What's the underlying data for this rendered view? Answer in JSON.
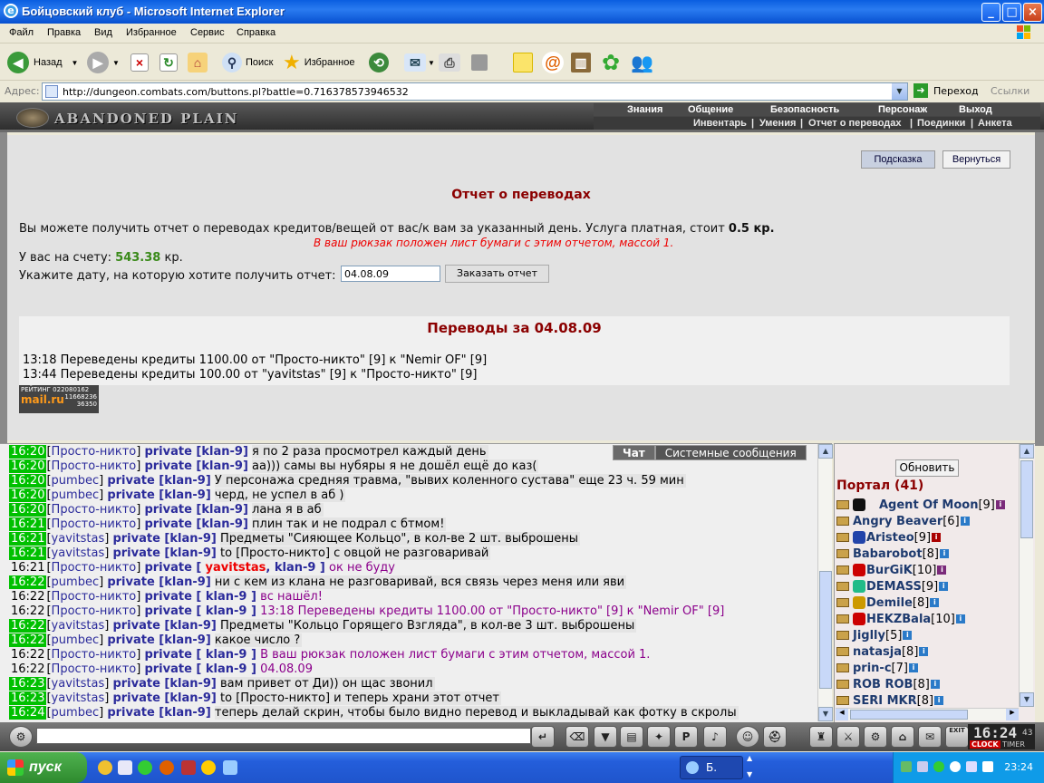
{
  "window": {
    "title": "Бойцовский клуб - Microsoft Internet Explorer",
    "min": "_",
    "max": "□",
    "close": "×"
  },
  "menu": [
    "Файл",
    "Правка",
    "Вид",
    "Избранное",
    "Сервис",
    "Справка"
  ],
  "toolbar": {
    "back": "Назад",
    "search": "Поиск",
    "favorites": "Избранное"
  },
  "address": {
    "label": "Адрес:",
    "url": "http://dungeon.combats.com/buttons.pl?battle=0.716378573946532",
    "go": "Переход",
    "links": "Ссылки"
  },
  "game": {
    "title": "ABANDONED PLAIN",
    "nav_top": [
      "Знания",
      "Общение",
      "Безопасность",
      "Персонаж",
      "Выход"
    ],
    "nav_bottom": [
      "Инвентарь",
      "|",
      "Умения",
      "|",
      "Отчет о переводах",
      "|",
      "Поединки",
      "|",
      "Анкета"
    ]
  },
  "page": {
    "hint_button": "Подсказка",
    "back_button": "Вернуться",
    "title": "Отчет о переводах",
    "description": "Вы можете получить отчет о переводах кредитов/вещей от вас/к вам за указанный день. Услуга платная, стоит ",
    "price": "0.5 кр.",
    "notice": "В ваш рюкзак положен лист бумаги с этим отчетом, массой 1.",
    "balance_label": "У вас на счету: ",
    "balance": "543.38",
    "balance_unit": " кр.",
    "date_label": "Укажите дату, на которую хотите получить отчет:",
    "date_value": "04.08.09",
    "order_button": "Заказать отчет",
    "transfers_title": "Переводы за 04.08.09",
    "transfers": [
      "13:18 Переведены кредиты 1100.00 от \"Просто-никто\" [9] к \"Nemir OF\" [9]",
      "13:44 Переведены кредиты 100.00 от \"yavitstas\" [9] к \"Просто-никто\" [9]"
    ],
    "counter": {
      "label": "РЕЙТИНГ",
      "brand": "mail.ru",
      "n1": "022080162",
      "n2": "11668236",
      "n3": "36350"
    }
  },
  "chat": {
    "tabs": [
      "Чат",
      "Системные сообщения"
    ],
    "lines": [
      {
        "time": "16:20",
        "green": true,
        "sender": "Просто-никто",
        "priv": "private [klan-9]",
        "msg": "я по 2 раза просмотрел каждый день",
        "hl": true
      },
      {
        "time": "16:20",
        "green": true,
        "sender": "Просто-никто",
        "priv": "private [klan-9]",
        "msg": "аа))) самы вы нубяры я не дошёл ещё до каз(",
        "hl": true
      },
      {
        "time": "16:20",
        "green": true,
        "sender": "pumbec",
        "priv": "private [klan-9]",
        "msg": "У персонажа средняя травма, \"вывих коленного сустава\" еще 23 ч. 59 мин",
        "hl": true
      },
      {
        "time": "16:20",
        "green": true,
        "sender": "pumbec",
        "priv": "private [klan-9]",
        "msg": "черд, не успел в аб )",
        "hl": true
      },
      {
        "time": "16:20",
        "green": true,
        "sender": "Просто-никто",
        "priv": "private [klan-9]",
        "msg": "лана я в аб",
        "hl": true
      },
      {
        "time": "16:21",
        "green": true,
        "sender": "Просто-никто",
        "priv": "private [klan-9]",
        "msg": "плин так и не подрал с бтмом!",
        "hl": true
      },
      {
        "time": "16:21",
        "green": true,
        "sender": "yavitstas",
        "priv": "private [klan-9]",
        "msg": "Предметы \"Сияющее Кольцо\", в кол-ве 2 шт. выброшены",
        "hl": true
      },
      {
        "time": "16:21",
        "green": true,
        "sender": "yavitstas",
        "priv": "private [klan-9]",
        "msg": "to [Просто-никто] с овцой не разговаривай",
        "hl": true
      },
      {
        "time": "16:21",
        "green": false,
        "sender": "Просто-никто",
        "priv": "private [",
        "red": "yavitstas",
        "priv2": ", klan-9 ]",
        "msg": "ок не буду",
        "purple": true
      },
      {
        "time": "16:22",
        "green": true,
        "sender": "pumbec",
        "priv": "private [klan-9]",
        "msg": "ни с кем из клана не разговаривай, вся связь через меня или яви",
        "hl": true
      },
      {
        "time": "16:22",
        "green": false,
        "sender": "Просто-никто",
        "priv": "private [ klan-9 ]",
        "msg": "вс нашёл!",
        "purple": true
      },
      {
        "time": "16:22",
        "green": false,
        "sender": "Просто-никто",
        "priv": "private [ klan-9 ]",
        "msg": "13:18 Переведены кредиты 1100.00 от \"Просто-никто\" [9] к \"Nemir OF\" [9]",
        "purple": true
      },
      {
        "time": "16:22",
        "green": true,
        "sender": "yavitstas",
        "priv": "private [klan-9]",
        "msg": "Предметы \"Кольцо Горящего Взгляда\", в кол-ве 3 шт. выброшены",
        "hl": true
      },
      {
        "time": "16:22",
        "green": true,
        "sender": "pumbec",
        "priv": "private [klan-9]",
        "msg": "какое число ?",
        "hl": true
      },
      {
        "time": "16:22",
        "green": false,
        "sender": "Просто-никто",
        "priv": "private [ klan-9 ]",
        "msg": "В ваш рюкзак положен лист бумаги с этим отчетом, массой 1.",
        "purple": true
      },
      {
        "time": "16:22",
        "green": false,
        "sender": "Просто-никто",
        "priv": "private [ klan-9 ]",
        "msg": "04.08.09",
        "purple": true
      },
      {
        "time": "16:23",
        "green": true,
        "sender": "yavitstas",
        "priv": "private [klan-9]",
        "msg": "вам привет от Ди)) он щас звонил",
        "hl": true
      },
      {
        "time": "16:23",
        "green": true,
        "sender": "yavitstas",
        "priv": "private [klan-9]",
        "msg": "to [Просто-никто] и теперь храни этот отчет",
        "hl": true
      },
      {
        "time": "16:24",
        "green": true,
        "sender": "pumbec",
        "priv": "private [klan-9]",
        "msg": "теперь делай скрин, чтобы было видно перевод и выкладывай как фотку в скролы",
        "hl": true
      }
    ]
  },
  "online": {
    "refresh": "Обновить",
    "title": "Портал (41)",
    "players": [
      {
        "nick": "Agent Of Moon",
        "lvl": "[9]"
      },
      {
        "nick": "Angry Beaver",
        "lvl": "[6]"
      },
      {
        "nick": "Aristeo",
        "lvl": "[9]"
      },
      {
        "nick": "Babarobot",
        "lvl": "[8]"
      },
      {
        "nick": "BurGiK",
        "lvl": "[10]"
      },
      {
        "nick": "DEMASS",
        "lvl": "[9]"
      },
      {
        "nick": "Demile",
        "lvl": "[8]"
      },
      {
        "nick": "HEKZBala",
        "lvl": "[10]"
      },
      {
        "nick": "Jiglly",
        "lvl": "[5]"
      },
      {
        "nick": "natasja",
        "lvl": "[8]"
      },
      {
        "nick": "prin-c",
        "lvl": "[7]"
      },
      {
        "nick": "ROB ROB",
        "lvl": "[8]"
      },
      {
        "nick": "SERI MKR",
        "lvl": "[8]"
      }
    ]
  },
  "bottom": {
    "clock": "16:24",
    "clock_sec": "43",
    "clock_label": "CLOCK",
    "timer_label": "TIMER",
    "exit": "EXIT"
  },
  "taskbar": {
    "start": "пуск",
    "task": "Б.",
    "time": "23:24"
  }
}
